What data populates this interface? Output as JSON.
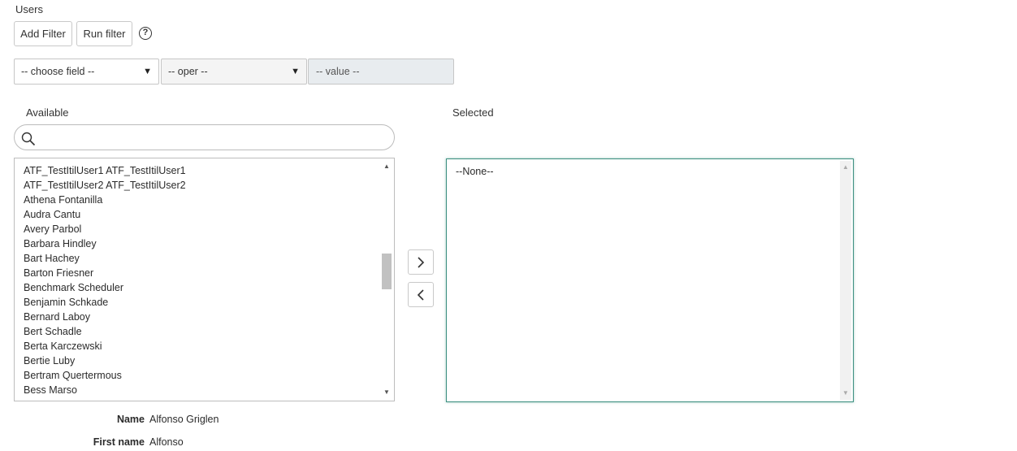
{
  "section": {
    "title": "Users"
  },
  "toolbar": {
    "add_filter_label": "Add Filter",
    "run_filter_label": "Run filter",
    "help_symbol": "?"
  },
  "filter": {
    "field_select": {
      "selected": "-- choose field --"
    },
    "operator_select": {
      "selected": "-- oper --"
    },
    "value_input": {
      "value": "-- value --"
    }
  },
  "slushbucket": {
    "available_label": "Available",
    "selected_label": "Selected",
    "search": {
      "value": "",
      "placeholder": ""
    },
    "available_items": [
      "ATF_TestItilUser1 ATF_TestItilUser1",
      "ATF_TestItilUser2 ATF_TestItilUser2",
      "Athena Fontanilla",
      "Audra Cantu",
      "Avery Parbol",
      "Barbara Hindley",
      "Bart Hachey",
      "Barton Friesner",
      "Benchmark Scheduler",
      "Benjamin Schkade",
      "Bernard Laboy",
      "Bert Schadle",
      "Berta Karczewski",
      "Bertie Luby",
      "Bertram Quertermous",
      "Bess Marso"
    ],
    "selected_items": [
      "--None--"
    ],
    "available_scroll_position": 0.45
  },
  "details": {
    "name_label": "Name",
    "name_value": "Alfonso Griglen",
    "first_name_label": "First name",
    "first_name_value": "Alfonso"
  },
  "icons": {
    "move_right": "chevron-right-icon",
    "move_left": "chevron-left-icon",
    "search": "search-icon",
    "help": "help-icon"
  },
  "colors": {
    "selected_border": "#3c8f80",
    "value_bg": "#e8ecef"
  }
}
